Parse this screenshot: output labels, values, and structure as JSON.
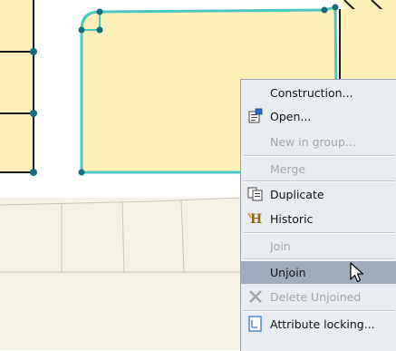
{
  "context_menu": {
    "items": [
      {
        "label": "Construction...",
        "icon": "none",
        "enabled": true
      },
      {
        "label": "Open...",
        "icon": "open-properties-icon",
        "enabled": true
      },
      {
        "label": "New in group...",
        "icon": "none",
        "enabled": false
      },
      {
        "label": "Merge",
        "icon": "none",
        "enabled": false
      },
      {
        "label": "Duplicate",
        "icon": "duplicate-icon",
        "enabled": true
      },
      {
        "label": "Historic",
        "icon": "historic-icon",
        "enabled": true
      },
      {
        "label": "Join",
        "icon": "none",
        "enabled": false
      },
      {
        "label": "Unjoin",
        "icon": "none",
        "enabled": true,
        "highlighted": true
      },
      {
        "label": "Delete Unjoined",
        "icon": "delete-x-icon",
        "enabled": false
      },
      {
        "label": "Attribute locking...",
        "icon": "attribute-locking-icon",
        "enabled": true
      }
    ]
  },
  "colors": {
    "parcel_fill": "#fdf0b9",
    "selected_outline": "#4ec6c1",
    "vertex": "#0e6e7a",
    "road_fill": "#f6f3e6",
    "menu_bg": "#e9ecf1",
    "menu_highlight": "#a0acbb"
  }
}
